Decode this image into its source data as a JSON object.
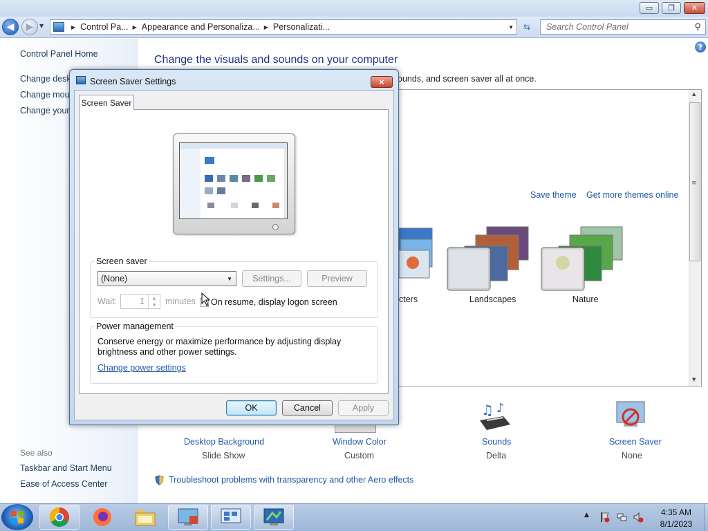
{
  "window": {
    "buttons": {
      "minimize": "▭",
      "maximize": "❐",
      "close": "✕"
    }
  },
  "address_bar": {
    "crumbs": [
      "Control Pa...",
      "Appearance and Personaliza...",
      "Personalizati..."
    ],
    "search_placeholder": "Search Control Panel"
  },
  "left_pane": {
    "home": "Control Panel Home",
    "links": [
      "Change deskt",
      "Change mous",
      "Change your"
    ],
    "see_also_title": "See also",
    "see_also": [
      "Taskbar and Start Menu",
      "Ease of Access Center"
    ]
  },
  "main": {
    "title": "Change the visuals and sounds on your computer",
    "description_visible": "ounds, and screen saver all at once.",
    "save_theme": "Save theme",
    "get_more_themes": "Get more themes online",
    "themes": [
      {
        "label": "cters"
      },
      {
        "label": "Landscapes"
      },
      {
        "label": "Nature"
      }
    ],
    "bottom_items": [
      {
        "label": "Desktop Background",
        "value": "Slide Show"
      },
      {
        "label": "Window Color",
        "value": "Custom"
      },
      {
        "label": "Sounds",
        "value": "Delta"
      },
      {
        "label": "Screen Saver",
        "value": "None"
      }
    ],
    "troubleshoot": "Troubleshoot problems with transparency and other Aero effects"
  },
  "dialog": {
    "title": "Screen Saver Settings",
    "tab": "Screen Saver",
    "screen_saver_group": "Screen saver",
    "selected_saver": "(None)",
    "settings_button": "Settings...",
    "preview_button": "Preview",
    "wait_label": "Wait:",
    "wait_value": "1",
    "minutes_label": "minutes",
    "resume_label": "On resume, display logon screen",
    "resume_checked": false,
    "power_group": "Power management",
    "power_text_line1": "Conserve energy or maximize performance by adjusting display",
    "power_text_line2": "brightness and other power settings.",
    "power_link": "Change power settings",
    "ok": "OK",
    "cancel": "Cancel",
    "apply": "Apply"
  },
  "taskbar": {
    "time": "4:35 AM",
    "date": "8/1/2023",
    "apps": [
      "chrome",
      "firefox",
      "file-explorer",
      "control-panel",
      "remote-desktop",
      "screen-saver-settings"
    ]
  },
  "colors": {
    "link": "#1e5aa8",
    "title_blue": "#1e3287",
    "left_link": "#1e395b"
  }
}
